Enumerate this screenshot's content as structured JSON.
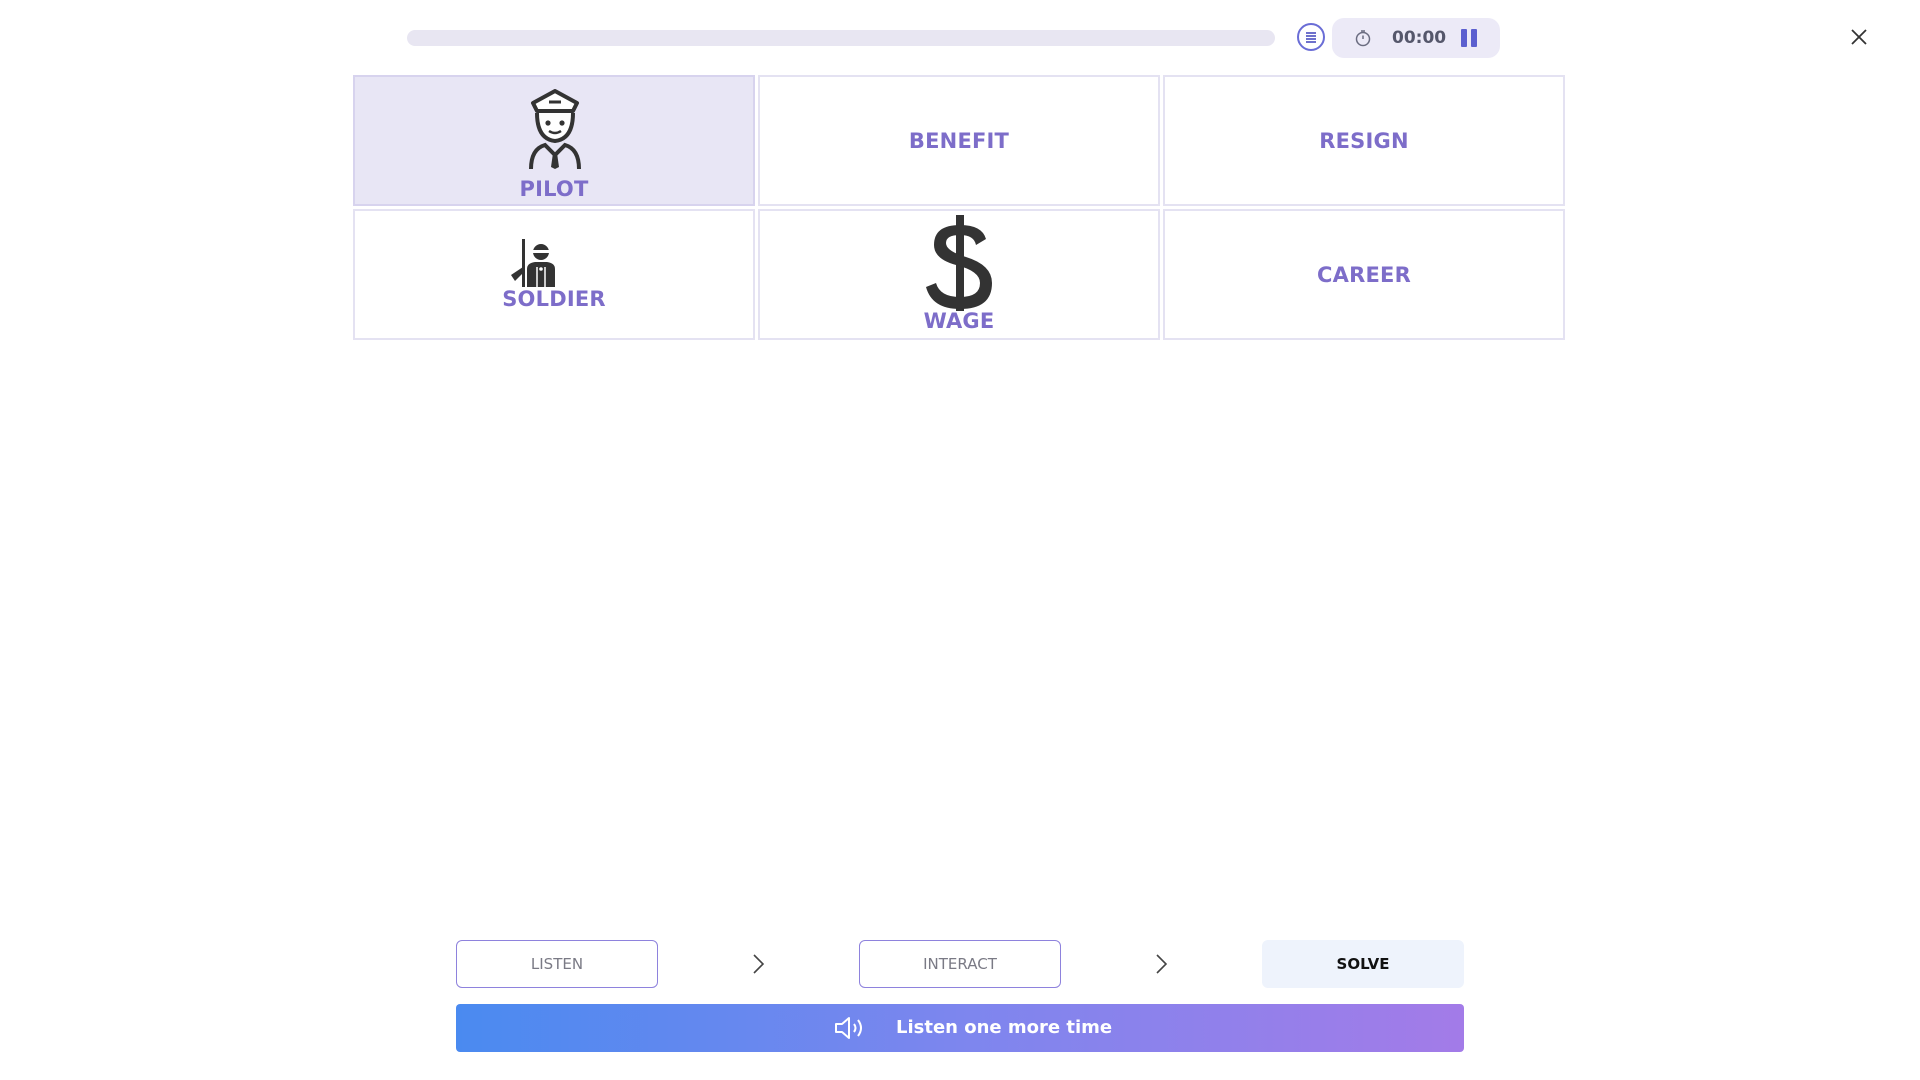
{
  "header": {
    "progress_fraction": 0,
    "timer": "00:00"
  },
  "cards": [
    {
      "label": "PILOT",
      "icon": "pilot-icon",
      "selected": true
    },
    {
      "label": "BENEFIT",
      "icon": null,
      "selected": false
    },
    {
      "label": "RESIGN",
      "icon": null,
      "selected": false
    },
    {
      "label": "SOLDIER",
      "icon": "soldier-icon",
      "selected": false
    },
    {
      "label": "WAGE",
      "icon": "dollar-icon",
      "selected": false
    },
    {
      "label": "CAREER",
      "icon": null,
      "selected": false
    }
  ],
  "steps": {
    "listen": "LISTEN",
    "interact": "INTERACT",
    "solve": "SOLVE"
  },
  "listen_button": {
    "label": "Listen one more time"
  },
  "colors": {
    "accent": "#7d6dc9",
    "selected_card_bg": "#e8e6f5",
    "gradient_start": "#4a8af0",
    "gradient_end": "#a37be8"
  }
}
